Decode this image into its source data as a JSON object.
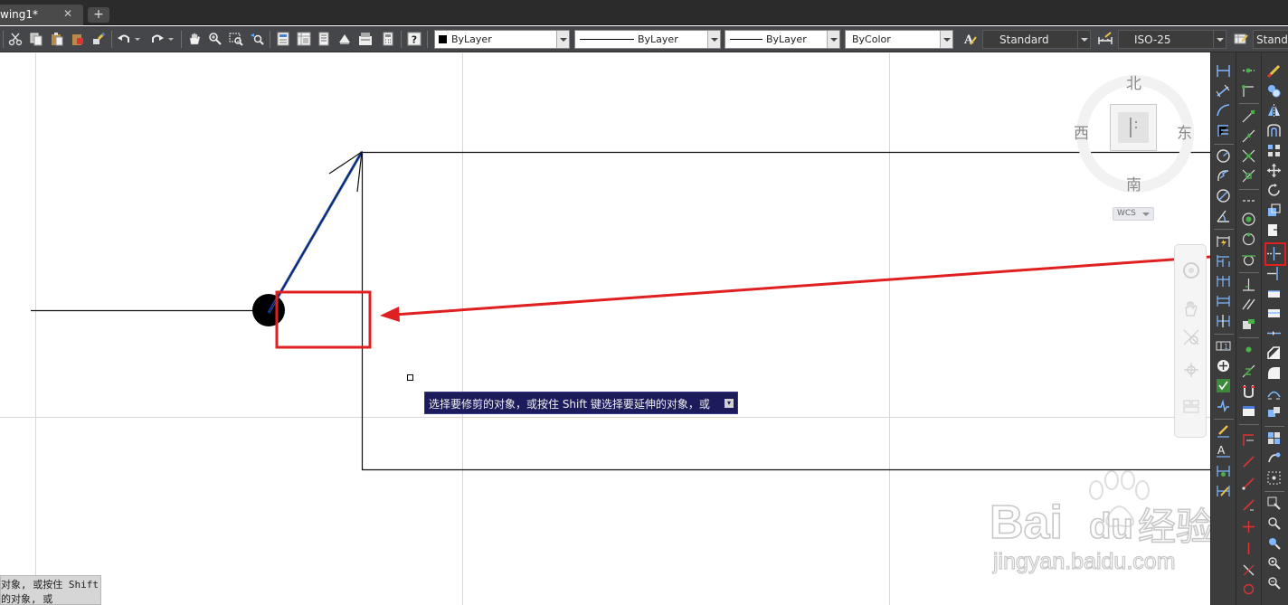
{
  "tabs": {
    "file_tab_label": "wing1*",
    "close_glyph": "✕",
    "new_tab_glyph": "+"
  },
  "toolbar": {
    "icons": [
      "cut-icon",
      "copy-icon",
      "paste-icon",
      "paste-block-icon",
      "match-properties-icon",
      "undo-icon",
      "redo-icon",
      "pan-icon",
      "zoom-realtime-icon",
      "zoom-window-icon",
      "zoom-previous-icon",
      "properties-icon",
      "design-center-icon",
      "tool-palettes-icon",
      "sheet-set-icon",
      "markup-icon",
      "calculator-icon",
      "help-icon"
    ],
    "color_combo": "ByLayer",
    "linetype_combo": "ByLayer",
    "lineweight_combo": "ByLayer",
    "plotstyle_combo": "ByColor",
    "text_style_combo": "Standard",
    "dim_style_combo": "ISO-25",
    "table_style_combo": "Standa"
  },
  "viewcube": {
    "north": "北",
    "south": "南",
    "east": "东",
    "west": "西",
    "wcs_label": "WCS"
  },
  "navbar": {
    "icons": [
      "steering-wheel-icon",
      "pan-hand-icon",
      "zoom-extents-icon",
      "orbit-icon",
      "showmotion-icon"
    ]
  },
  "tooltip": {
    "text": "选择要修剪的对象，或按住 Shift 键选择要延伸的对象，或",
    "button_glyph": "▾"
  },
  "command_history": {
    "line1": "对象, 或按住 Shift",
    "line2": "的对象, 或"
  },
  "watermark": {
    "brand": "Bai",
    "brand_suffix": "du",
    "site_cn": "经验",
    "url": "jingyan.baidu.com"
  },
  "colors": {
    "annotation_red": "#e02020",
    "selected_blue": "#1f4fb8",
    "tooltip_bg": "#1c1c5c"
  },
  "panels": {
    "panel_a_icons": [
      "linear-dim-icon",
      "aligned-dim-icon",
      "arc-length-icon",
      "ordinate-dim-icon",
      "radius-dim-icon",
      "jogged-icon",
      "diameter-dim-icon",
      "angular-dim-icon",
      "quick-dim-icon",
      "baseline-dim-icon",
      "continue-dim-icon",
      "dim-space-icon",
      "dim-break-icon",
      "tolerance-icon",
      "center-mark-icon",
      "inspection-icon",
      "jogged-linear-icon",
      "dim-edit-icon",
      "dim-text-edit-icon",
      "dim-update-icon",
      "dim-style-icon"
    ],
    "panel_b_icons": [
      "snap-temp-icon",
      "snap-from-icon",
      "snap-endpoint-icon",
      "snap-midpoint-icon",
      "snap-intersection-icon",
      "snap-apparent-icon",
      "snap-extension-icon",
      "snap-center-icon",
      "snap-quadrant-icon",
      "snap-tangent-icon",
      "snap-perpendicular-icon",
      "snap-parallel-icon",
      "snap-insert-icon",
      "snap-node-icon",
      "snap-nearest-icon",
      "snap-none-icon",
      "snap-settings-icon"
    ],
    "panel_c_icons": [
      "erase-icon",
      "copy-object-icon",
      "mirror-icon",
      "offset-icon",
      "array-icon",
      "move-icon",
      "rotate-icon",
      "scale-icon",
      "stretch-icon",
      "trim-icon",
      "extend-icon",
      "break-at-point-icon",
      "break-icon",
      "join-icon",
      "chamfer-icon",
      "fillet-icon",
      "blend-icon",
      "explode-icon",
      "group-icon",
      "ungroup-icon",
      "select-similar-icon",
      "zoom-in-icon",
      "zoom-out-icon"
    ]
  }
}
